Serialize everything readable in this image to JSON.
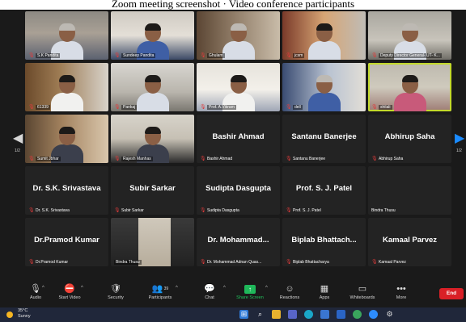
{
  "caption": "Zoom meeting screenshot · Video conference participants",
  "participants": [
    {
      "name": "S.K Pandita",
      "type": "video",
      "style": "t0",
      "shirt": "shirt-light",
      "hair": "grey-hair"
    },
    {
      "name": "Sundeep Pandita",
      "type": "video",
      "style": "t1",
      "shirt": "shirt-blue",
      "hair": ""
    },
    {
      "name": "Ghulam",
      "type": "video",
      "style": "t2",
      "shirt": "shirt-light",
      "hair": "grey-hair"
    },
    {
      "name": "jcsm",
      "type": "video",
      "style": "t3",
      "shirt": "shirt-light",
      "hair": ""
    },
    {
      "name": "Deputy Director General- UT- K...",
      "type": "video",
      "style": "t4",
      "shirt": "shirt-light",
      "hair": "grey-hair"
    },
    {
      "name": "61339",
      "type": "video",
      "style": "t5",
      "shirt": "shirt-white",
      "hair": ""
    },
    {
      "name": "Pankaj",
      "type": "video",
      "style": "t6",
      "shirt": "shirt-light",
      "hair": ""
    },
    {
      "name": "Prof. A.Vikram",
      "type": "video",
      "style": "t7",
      "shirt": "shirt-white",
      "hair": ""
    },
    {
      "name": "dell",
      "type": "video",
      "style": "t8",
      "shirt": "shirt-blue",
      "hair": "grey-hair"
    },
    {
      "name": "shilali",
      "type": "video",
      "style": "t9",
      "shirt": "shirt-pink",
      "hair": "",
      "active": true
    },
    {
      "name": "Sumit Jbhar",
      "type": "video",
      "style": "t10",
      "shirt": "",
      "hair": ""
    },
    {
      "name": "Rajesh Manhas",
      "type": "video",
      "style": "t11",
      "shirt": "",
      "hair": ""
    },
    {
      "name": "Bashir Ahmad",
      "display": "Bashir Ahmad",
      "type": "name"
    },
    {
      "name": "Santanu Banerjee",
      "display": "Santanu Banerjee",
      "type": "name"
    },
    {
      "name": "Abhirup Saha",
      "display": "Abhirup Saha",
      "type": "name"
    },
    {
      "name": "Dr. S.K. Srivastava",
      "display": "Dr. S.K. Srivastava",
      "type": "name"
    },
    {
      "name": "Subir Sarkar",
      "display": "Subir Sarkar",
      "type": "name"
    },
    {
      "name": "Sudipta Dasgupta",
      "display": "Sudipta Dasgupta",
      "type": "name"
    },
    {
      "name": "Prof. S. J. Patel",
      "display": "Prof. S. J. Patel",
      "type": "name"
    },
    {
      "name": "Bindra Thusu",
      "display": "",
      "type": "name",
      "nomic": true
    },
    {
      "name": "Dr.Pramod Kumar",
      "display": "Dr.Pramod Kumar",
      "type": "name"
    },
    {
      "name": "Bindra Thusu",
      "type": "video",
      "style": "t12",
      "shirt": "",
      "hair": "",
      "nomic": true
    },
    {
      "name": "Dr. Mohammad Adnan Quas...",
      "display": "Dr. Mohammad...",
      "type": "name"
    },
    {
      "name": "Biplab Bhattacharya",
      "display": "Biplab Bhattach...",
      "type": "name"
    },
    {
      "name": "Kamaal Parvez",
      "display": "Kamaal Parvez",
      "type": "name"
    }
  ],
  "pagination": {
    "left": "1/2",
    "right": "1/2"
  },
  "toolbar": {
    "audio": "Audio",
    "start_video": "Start Video",
    "security": "Security",
    "participants": "Participants",
    "participants_count": "39",
    "chat": "Chat",
    "share_screen": "Share Screen",
    "reactions": "Reactions",
    "apps": "Apps",
    "whiteboards": "Whiteboards",
    "more": "More",
    "end": "End"
  },
  "taskbar": {
    "temp": "35°C",
    "condition": "Sunny"
  },
  "colors": {
    "active_speaker": "#c3d92c",
    "share_green": "#1fb85a",
    "end_red": "#d92027",
    "muted_red": "#e03b3b"
  }
}
